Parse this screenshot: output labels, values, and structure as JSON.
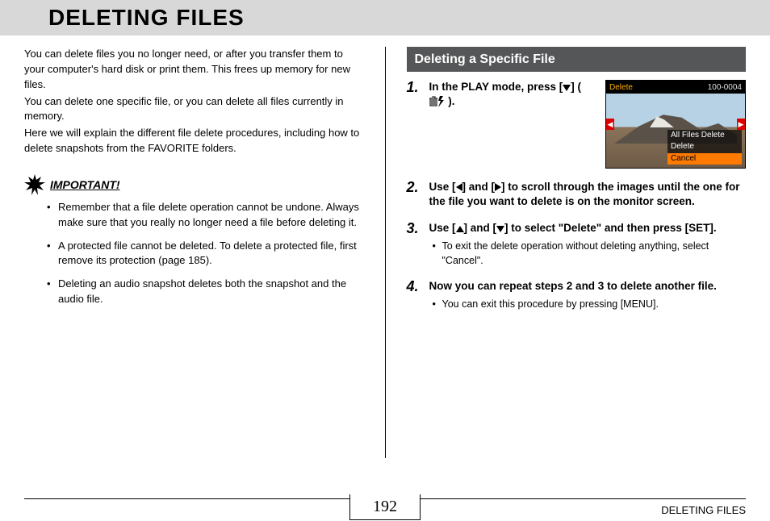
{
  "header": {
    "title": "DELETING FILES"
  },
  "intro": {
    "p1": "You can delete files you no longer need, or after you transfer them to your computer's hard disk or print them. This frees up memory for new files.",
    "p2": "You can delete one specific file, or you can delete all files currently in memory.",
    "p3": "Here we will explain the different file delete procedures, including how to delete snapshots from the FAVORITE folders."
  },
  "important": {
    "label": "IMPORTANT!",
    "items": [
      "Remember that a file delete operation cannot be undone. Always make sure that you really no longer need a file before deleting it.",
      "A protected file cannot be deleted. To delete a protected file, first remove its protection (page 185).",
      "Deleting an audio snapshot deletes both the snapshot and the audio file."
    ]
  },
  "section": {
    "title": "Deleting a Specific File",
    "steps": {
      "1": {
        "pre": "In the PLAY mode, press [",
        "mid": "] ( ",
        "post": " )."
      },
      "2": {
        "text_pre": "Use [",
        "text_mid1": "] and [",
        "text_mid2": "] to scroll through the images until the one for the file you want to delete is on the monitor screen."
      },
      "3": {
        "text_pre": "Use [",
        "text_mid1": "] and [",
        "text_mid2": "] to select \"Delete\" and then press [SET].",
        "sub": "To exit the delete operation without deleting anything, select \"Cancel\"."
      },
      "4": {
        "text": "Now you can repeat steps 2 and 3 to delete another file.",
        "sub": "You can exit this procedure by pressing [MENU]."
      }
    }
  },
  "camera": {
    "top_left": "Delete",
    "top_right": "100-0004",
    "menu": [
      "All Files Delete",
      "Delete",
      "Cancel"
    ],
    "selected": "Cancel"
  },
  "footer": {
    "page_number": "192",
    "label": "DELETING FILES"
  }
}
